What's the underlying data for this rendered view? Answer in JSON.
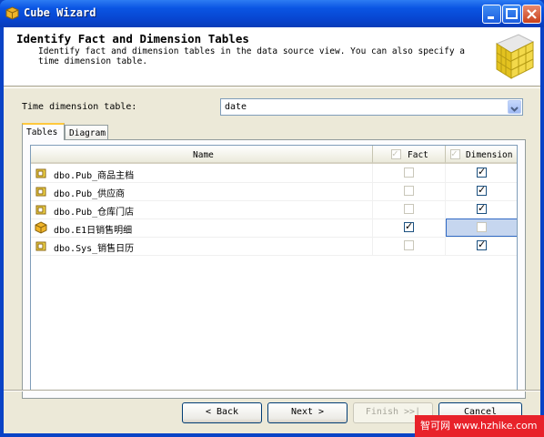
{
  "window": {
    "title": "Cube Wizard",
    "accent": "#0a55e3",
    "close_color": "#c9411b"
  },
  "header": {
    "title": "Identify Fact and Dimension Tables",
    "description": "Identify fact and dimension tables in the data source view. You can also specify a time dimension table."
  },
  "time_dimension": {
    "label": "Time dimension table:",
    "value": "date"
  },
  "tabs": [
    {
      "label": "Tables",
      "active": true
    },
    {
      "label": "Diagram",
      "active": false
    }
  ],
  "grid": {
    "columns": {
      "name": "Name",
      "fact": "Fact",
      "dimension": "Dimension"
    },
    "rows": [
      {
        "name": "dbo.Pub_商品主档",
        "fact": false,
        "dimension": true
      },
      {
        "name": "dbo.Pub_供应商",
        "fact": false,
        "dimension": true
      },
      {
        "name": "dbo.Pub_仓库门店",
        "fact": false,
        "dimension": true
      },
      {
        "name": "dbo.E1日销售明细",
        "fact": true,
        "dimension": false
      },
      {
        "name": "dbo.Sys_销售日历",
        "fact": false,
        "dimension": true
      }
    ]
  },
  "buttons": {
    "back": "< Back",
    "next": "Next >",
    "finish": "Finish >>|",
    "cancel": "Cancel"
  },
  "watermark": "智可网 www.hzhike.com"
}
